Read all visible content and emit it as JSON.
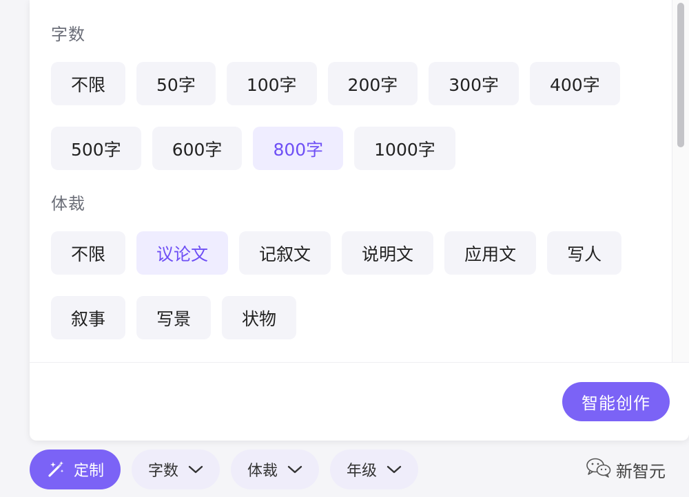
{
  "word_count": {
    "title": "字数",
    "options": [
      "不限",
      "50字",
      "100字",
      "200字",
      "300字",
      "400字",
      "500字",
      "600字",
      "800字",
      "1000字"
    ],
    "selected_index": 8
  },
  "genre": {
    "title": "体裁",
    "options": [
      "不限",
      "议论文",
      "记叙文",
      "说明文",
      "应用文",
      "写人",
      "叙事",
      "写景",
      "状物"
    ],
    "selected_index": 1
  },
  "actions": {
    "create_label": "智能创作"
  },
  "bottom_bar": {
    "custom_label": "定制",
    "filters": [
      "字数",
      "体裁",
      "年级"
    ]
  },
  "watermark": {
    "text": "新智元"
  },
  "colors": {
    "accent": "#7b63f6",
    "selected_text": "#6e4ff5",
    "selected_bg": "#efedff",
    "chip_bg": "#f4f4f9"
  },
  "icons": {
    "custom": "magic-wand-icon",
    "filter": "chevron-down-icon",
    "watermark": "wechat-icon"
  }
}
